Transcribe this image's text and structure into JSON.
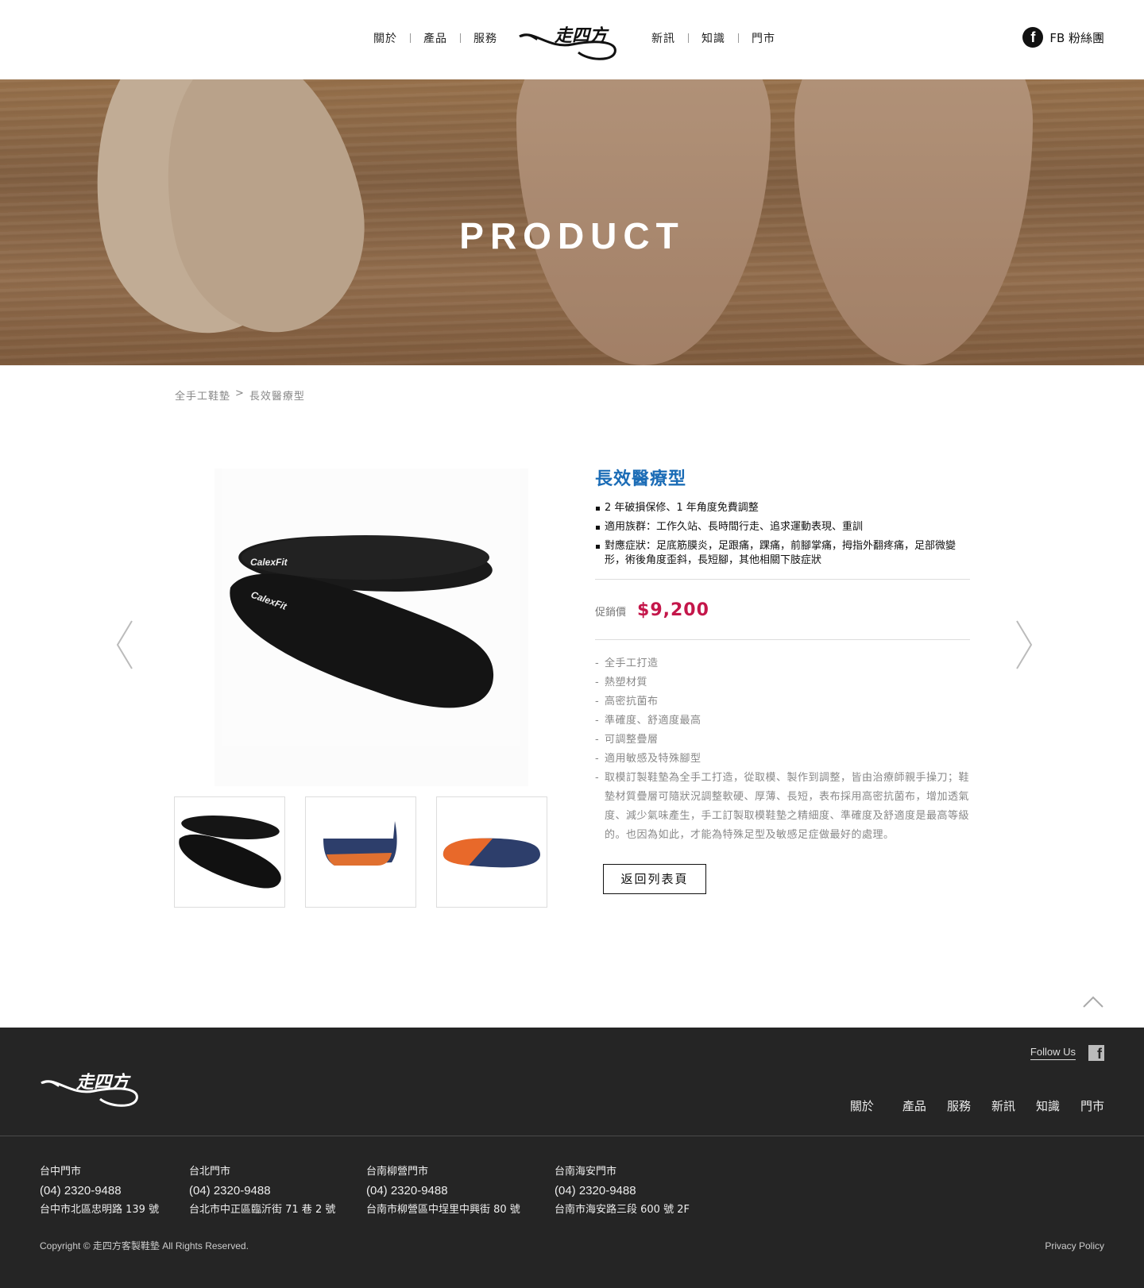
{
  "header": {
    "nav_left": [
      "關於",
      "產品",
      "服務"
    ],
    "nav_right": [
      "新訊",
      "知識",
      "門市"
    ],
    "brand": "走四方",
    "fb_label": "FB 粉絲團"
  },
  "hero": {
    "title": "PRODUCT"
  },
  "breadcrumb": {
    "parent": "全手工鞋墊",
    "separator": ">",
    "current": "長效醫療型"
  },
  "product": {
    "title": "長效醫療型",
    "features": [
      "2 年破損保修、1 年角度免費調整",
      "適用族群：工作久站、長時間行走、追求運動表現、重訓",
      "對應症狀：足底筋膜炎，足跟痛，踝痛，前腳掌痛，拇指外翻疼痛，足部微變形，術後角度歪斜，長短腳，其他相關下肢症狀"
    ],
    "price_label": "促銷價",
    "price": "$9,200",
    "specs": [
      "全手工打造",
      "熱塑材質",
      "高密抗菌布",
      "準確度、舒適度最高",
      "可調整疊層",
      "適用敏感及特殊腳型",
      "取模訂製鞋墊為全手工打造，從取模、製作到調整，皆由治療師親手操刀；鞋墊材質疊層可隨狀況調整軟硬、厚薄、長短，表布採用高密抗菌布，增加透氣度、減少氣味產生，手工訂製取模鞋墊之精細度、準確度及舒適度是最高等級的。也因為如此，才能為特殊足型及敏感足症做最好的處理。"
    ],
    "back_button": "返回列表頁",
    "image_text": "CalexFit"
  },
  "footer": {
    "brand": "走四方",
    "follow_label": "Follow Us",
    "nav": [
      "關於",
      "產品",
      "服務",
      "新訊",
      "知識",
      "門市"
    ],
    "stores": [
      {
        "name": "台中門市",
        "phone": "(04) 2320-9488",
        "address": "台中市北區忠明路 139 號"
      },
      {
        "name": "台北門市",
        "phone": "(04) 2320-9488",
        "address": "台北市中正區臨沂街 71 巷 2 號"
      },
      {
        "name": "台南柳營門市",
        "phone": "(04) 2320-9488",
        "address": "台南市柳營區中埕里中興街 80 號"
      },
      {
        "name": "台南海安門市",
        "phone": "(04) 2320-9488",
        "address": "台南市海安路三段 600 號 2F"
      }
    ],
    "copyright": "Copyright © 走四方客製鞋墊 All Rights Reserved.",
    "privacy": "Privacy Policy"
  },
  "colors": {
    "accent_blue": "#1b6cb6",
    "price_red": "#c4164a",
    "footer_bg": "#252525"
  }
}
